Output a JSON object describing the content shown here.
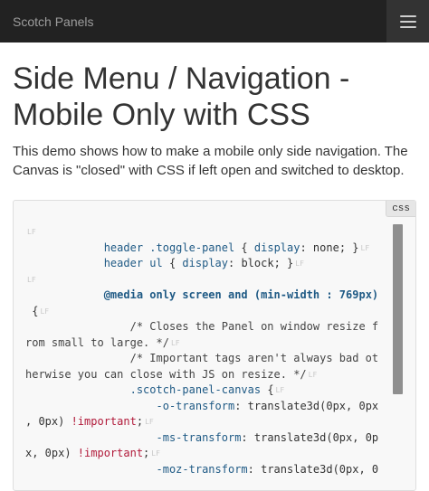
{
  "navbar": {
    "brand": "Scotch Panels",
    "menu_icon": "hamburger-icon"
  },
  "page": {
    "title": "Side Menu / Navigation - Mobile Only with CSS",
    "description": "This demo shows how to make a mobile only side navigation. The Canvas is \"closed\" with CSS if left open and switched to desktop."
  },
  "code": {
    "language": "css",
    "lf_marker": "LF",
    "lines": {
      "l2a": "header .toggle-panel",
      "l2b": " { ",
      "l2c": "display",
      "l2d": ": none; }",
      "l3a": "header ul",
      "l3b": " { ",
      "l3c": "display",
      "l3d": ": block; }",
      "l5a": "@media only screen and (min-width : 769px)",
      "l6a": " {",
      "l7a": "/* Closes the Panel on window resize f",
      "l8a": "rom small to large. */",
      "l9a": "/* Important tags aren't always bad ot",
      "l10a": "herwise you can close with JS on resize. */",
      "l11a": ".scotch-panel-canvas",
      "l11b": " {",
      "l12a": "-o-transform",
      "l12b": ": translate3d(0px, 0px",
      "l13a": ", 0px) ",
      "l13b": "!important",
      "l13c": ";",
      "l14a": "-ms-transform",
      "l14b": ": translate3d(0px, 0p",
      "l15a": "x, 0px) ",
      "l15b": "!important",
      "l15c": ";",
      "l16a": "-moz-transform",
      "l16b": ": translate3d(0px, 0"
    }
  }
}
